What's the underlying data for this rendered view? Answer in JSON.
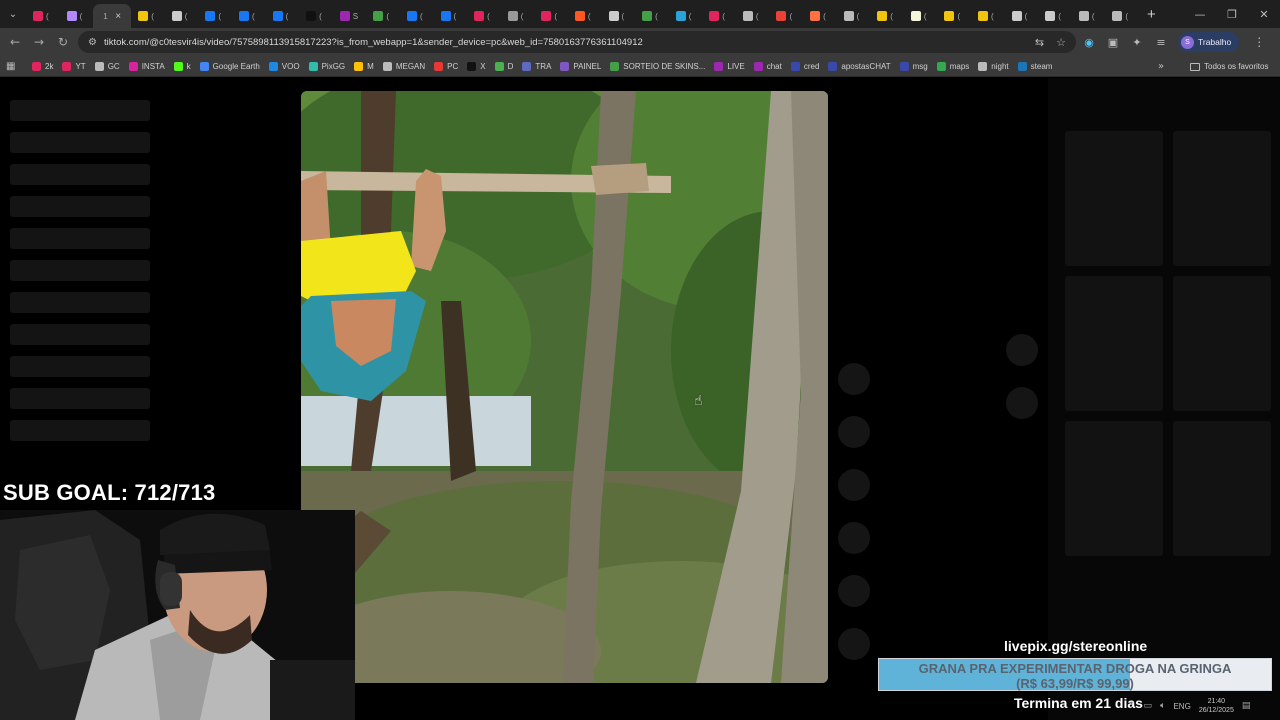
{
  "browser": {
    "tab_menu_icon": "chevron-down-icon",
    "tabs": [
      {
        "label": "(",
        "color": "#e0245e",
        "active": false
      },
      {
        "label": "(",
        "color": "#b388ff",
        "active": false
      },
      {
        "label": "1",
        "color": "#3a3a3a",
        "active": true
      },
      {
        "label": "(",
        "color": "#f1c40f",
        "active": false
      },
      {
        "label": "(",
        "color": "#cccccc",
        "active": false
      },
      {
        "label": "(",
        "color": "#1877f2",
        "active": false
      },
      {
        "label": "(",
        "color": "#1877f2",
        "active": false
      },
      {
        "label": "(",
        "color": "#1877f2",
        "active": false
      },
      {
        "label": "(",
        "color": "#111111",
        "active": false
      },
      {
        "label": "S",
        "color": "#9c27b0",
        "active": false
      },
      {
        "label": "(",
        "color": "#43a047",
        "active": false
      },
      {
        "label": "(",
        "color": "#1877f2",
        "active": false
      },
      {
        "label": "(",
        "color": "#1877f2",
        "active": false
      },
      {
        "label": "(",
        "color": "#e0245e",
        "active": false
      },
      {
        "label": "(",
        "color": "#999999",
        "active": false
      },
      {
        "label": "(",
        "color": "#e0245e",
        "active": false
      },
      {
        "label": "(",
        "color": "#ff5722",
        "active": false
      },
      {
        "label": "(",
        "color": "#cccccc",
        "active": false
      },
      {
        "label": "(",
        "color": "#43a047",
        "active": false
      },
      {
        "label": "(",
        "color": "#2aa3d9",
        "active": false
      },
      {
        "label": "(",
        "color": "#e0245e",
        "active": false
      },
      {
        "label": "(",
        "color": "#bbbbbb",
        "active": false
      },
      {
        "label": "(",
        "color": "#ea4335",
        "active": false
      },
      {
        "label": "(",
        "color": "#ff7043",
        "active": false
      },
      {
        "label": "(",
        "color": "#bbbbbb",
        "active": false
      },
      {
        "label": "(",
        "color": "#f1c40f",
        "active": false
      },
      {
        "label": "(",
        "color": "#f5f5dc",
        "active": false
      },
      {
        "label": "(",
        "color": "#f1c40f",
        "active": false
      },
      {
        "label": "(",
        "color": "#f1c40f",
        "active": false
      },
      {
        "label": "(",
        "color": "#cccccc",
        "active": false
      },
      {
        "label": "(",
        "color": "#cccccc",
        "active": false
      },
      {
        "label": "(",
        "color": "#bbbbbb",
        "active": false
      },
      {
        "label": "(",
        "color": "#bbbbbb",
        "active": false
      }
    ],
    "active_tab_close": "×",
    "new_tab": "+",
    "window_controls": {
      "minimize": "—",
      "restore": "❐",
      "close": "✕"
    },
    "nav": {
      "back": "←",
      "forward": "→",
      "reload": "↻"
    },
    "url": "tiktok.com/@c0tesvir4is/video/7575898113915817223?is_from_webapp=1&sender_device=pc&web_id=7580163776361104912",
    "profile": {
      "initial": "S",
      "label": "Trabalho"
    },
    "bookmarks": [
      {
        "label": "2k",
        "color": "#e0245e"
      },
      {
        "label": "YT",
        "color": "#e0245e"
      },
      {
        "label": "GC",
        "color": "#bbbbbb"
      },
      {
        "label": "INSTA",
        "color": "#d6249f"
      },
      {
        "label": "k",
        "color": "#53fc18"
      },
      {
        "label": "Google Earth",
        "color": "#4285f4"
      },
      {
        "label": "VOO",
        "color": "#1e88e5"
      },
      {
        "label": "PixGG",
        "color": "#32bcad"
      },
      {
        "label": "M",
        "color": "#ffc107"
      },
      {
        "label": "MEGAN",
        "color": "#bbbbbb"
      },
      {
        "label": "PC",
        "color": "#e53935"
      },
      {
        "label": "X",
        "color": "#111111"
      },
      {
        "label": "D",
        "color": "#4caf50"
      },
      {
        "label": "TRA",
        "color": "#5c6bc0"
      },
      {
        "label": "PAINEL",
        "color": "#7e57c2"
      },
      {
        "label": "SORTEIO DE SKINS...",
        "color": "#43a047"
      },
      {
        "label": "LIVE",
        "color": "#9c27b0"
      },
      {
        "label": "chat",
        "color": "#9c27b0"
      },
      {
        "label": "cred",
        "color": "#3949ab"
      },
      {
        "label": "apostasCHAT",
        "color": "#3949ab"
      },
      {
        "label": "msg",
        "color": "#3949ab"
      },
      {
        "label": "maps",
        "color": "#34a853"
      },
      {
        "label": "night",
        "color": "#bbbbbb"
      },
      {
        "label": "steam",
        "color": "#1b75bb"
      }
    ],
    "bookmarks_more": "»",
    "all_bookmarks": "Todos os favoritos"
  },
  "overlay": {
    "sub_goal": "SUB GOAL: 712/713",
    "livepix": "livepix.gg/stereonline",
    "goal_line1": "GRANA PRA EXPERIMENTAR DROGA NA GRINGA",
    "goal_line2": "(R$ 63,99/R$ 99,99)",
    "goal_progress": 0.64,
    "ends_in": "Termina em 21 dias"
  },
  "taskbar": {
    "lang": "ENG",
    "time": "21:40",
    "date": "26/12/2025"
  },
  "colors": {
    "chrome_dark": "#1f1f1f",
    "chrome_toolbar": "#3a3a3a",
    "goal_fill": "#5fb3d8",
    "goal_track": "#e9edf1"
  }
}
